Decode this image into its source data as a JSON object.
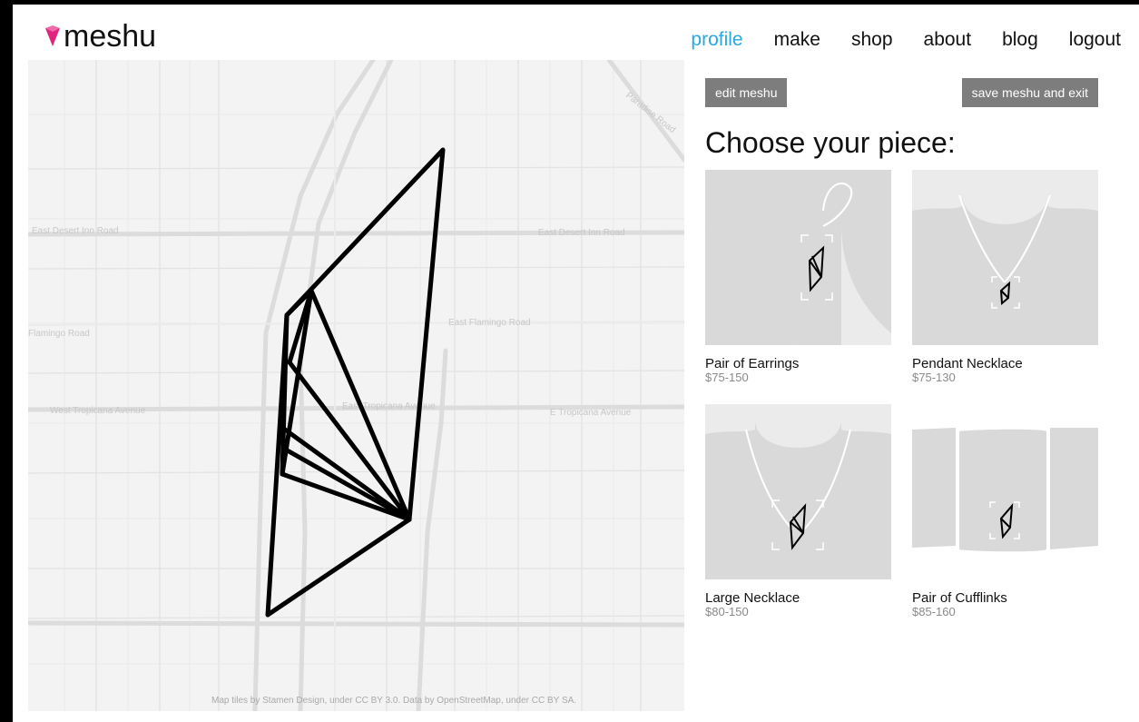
{
  "header": {
    "logo_text": "meshu",
    "nav": [
      {
        "label": "profile",
        "active": true
      },
      {
        "label": "make",
        "active": false
      },
      {
        "label": "shop",
        "active": false
      },
      {
        "label": "about",
        "active": false
      },
      {
        "label": "blog",
        "active": false
      },
      {
        "label": "logout",
        "active": false
      }
    ]
  },
  "map": {
    "street_labels": [
      "East Desert Inn Road",
      "East Desert Inn Road",
      "East Flamingo Road",
      "West Tropicana Avenue",
      "E Tropicana Avenue",
      "East Tropicana Avenue",
      "Flamingo Road",
      "Paradise Road"
    ],
    "attribution": "Map tiles by Stamen Design, under CC BY 3.0. Data by OpenStreetMap, under CC BY SA."
  },
  "actions": {
    "edit_label": "edit meshu",
    "save_label": "save meshu and exit"
  },
  "choose": {
    "title": "Choose your piece:",
    "pieces": [
      {
        "name": "Pair of Earrings",
        "price": "$75-150"
      },
      {
        "name": "Pendant Necklace",
        "price": "$75-130"
      },
      {
        "name": "Large Necklace",
        "price": "$80-150"
      },
      {
        "name": "Pair of Cufflinks",
        "price": "$85-160"
      }
    ]
  },
  "colors": {
    "accent": "#29a8df",
    "logo_gem": "#e0257f",
    "button": "#7d7d7d",
    "thumb_bg": "#d9d9d9"
  }
}
